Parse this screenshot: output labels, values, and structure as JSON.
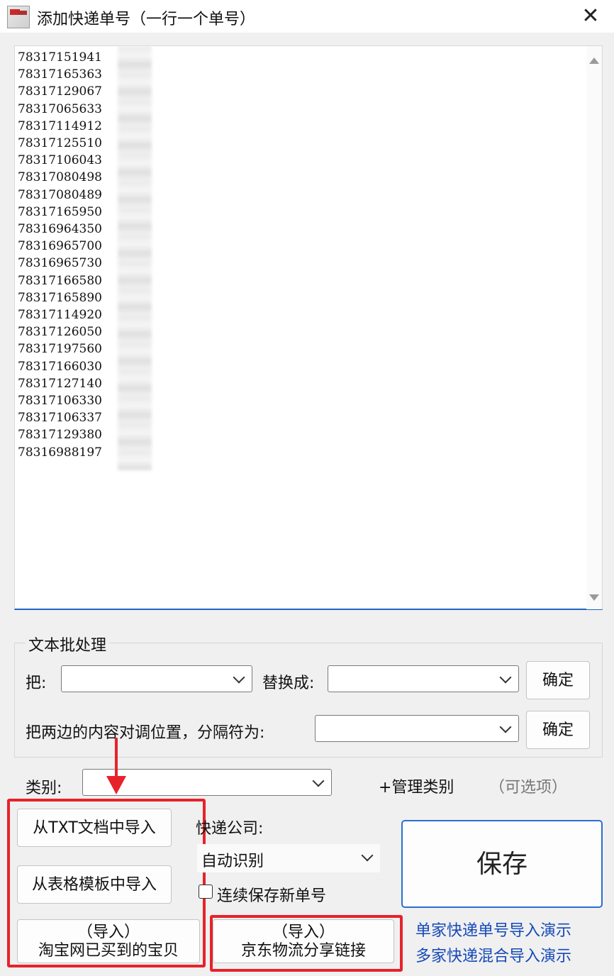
{
  "window": {
    "title": "添加快递单号（一行一个单号）",
    "close_glyph": "✕"
  },
  "tracking_numbers": [
    "78317151941",
    "78317165363",
    "78317129067",
    "78317065633",
    "78317114912",
    "78317125510",
    "78317106043",
    "78317080498",
    "78317080489",
    "78317165950",
    "78316964350",
    "78316965700",
    "78316965730",
    "78317166580",
    "78317165890",
    "78317114920",
    "78317126050",
    "78317197560",
    "78317166030",
    "78317127140",
    "78317106330",
    "78317106337",
    "78317129380",
    "78316988197"
  ],
  "batch": {
    "group_title": "文本批处理",
    "replace_from_label": "把:",
    "replace_from_value": "",
    "replace_to_label": "替换成:",
    "replace_to_value": "",
    "confirm_label": "确定",
    "swap_label": "把两边的内容对调位置，分隔符为:",
    "swap_value": ""
  },
  "category": {
    "label": "类别:",
    "value": "",
    "manage_label": "+管理类别",
    "optional_label": "（可选项）"
  },
  "import": {
    "from_txt": "从TXT文档中导入",
    "from_template": "从表格模板中导入",
    "taobao_line1": "（导入）",
    "taobao_line2": "淘宝网已买到的宝贝",
    "jd_line1": "（导入）",
    "jd_line2": "京东物流分享链接"
  },
  "courier": {
    "label": "快递公司:",
    "value": "自动识别",
    "continuous_label": "连续保存新单号",
    "continuous_checked": false
  },
  "save_label": "保存",
  "links": {
    "single_demo": "单家快递单号导入演示",
    "multi_demo": "多家快递混合导入演示"
  },
  "colors": {
    "annotation_red": "#e6232a",
    "accent_blue": "#2a6fd0",
    "link_blue": "#1549b8"
  }
}
